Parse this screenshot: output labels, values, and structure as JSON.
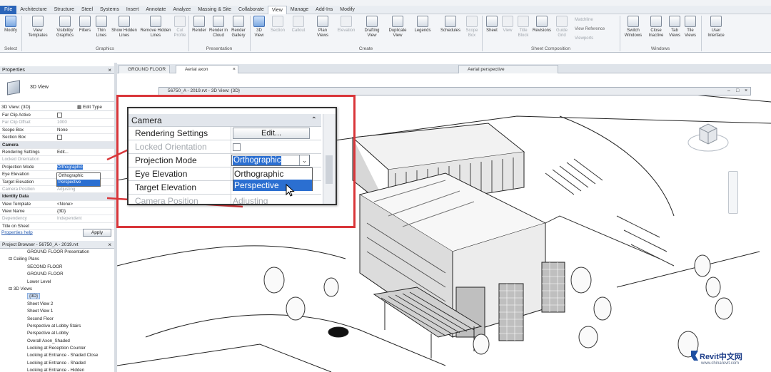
{
  "menubar": {
    "items": [
      "File",
      "Architecture",
      "Structure",
      "Steel",
      "Systems",
      "Insert",
      "Annotate",
      "Analyze",
      "Massing & Site",
      "Collaborate",
      "View",
      "Manage",
      "Add-Ins",
      "Modify"
    ],
    "active": "View"
  },
  "ribbon": {
    "buttons": {
      "modify": "Modify",
      "view_templates": "View Templates",
      "visibility_graphics": "Visibility/ Graphics",
      "filters": "Filters",
      "thin_lines": "Thin Lines",
      "show_hidden_lines": "Show Hidden Lines",
      "remove_hidden_lines": "Remove Hidden Lines",
      "cut_profile": "Cut Profile",
      "render": "Render",
      "render_cloud": "Render in Cloud",
      "render_gallery": "Render Gallery",
      "view_3d": "3D View",
      "section": "Section",
      "callout": "Callout",
      "plan_views": "Plan Views",
      "elevation": "Elevation",
      "drafting_view": "Drafting View",
      "duplicate_view": "Duplicate View",
      "legends": "Legends",
      "schedules": "Schedules",
      "scope_box": "Scope Box",
      "sheet": "Sheet",
      "view": "View",
      "title_block": "Title Block",
      "revisions": "Revisions",
      "guide_grid": "Guide Grid",
      "switch_windows": "Switch Windows",
      "close_inactive": "Close Inactive",
      "tab_views": "Tab Views",
      "tile_views": "Tile Views",
      "user_interface": "User Interface"
    },
    "small": {
      "matchline": "Matchline",
      "view_reference": "View  Reference",
      "viewports": "Viewports"
    },
    "groups": {
      "select": "Select",
      "graphics": "Graphics",
      "presentation": "Presentation",
      "create": "Create",
      "sheet_composition": "Sheet Composition",
      "windows": "Windows"
    }
  },
  "properties": {
    "title": "Properties",
    "type_name": "3D View",
    "instance_selector": "3D View: {3D}",
    "edit_type": "Edit Type",
    "rows": [
      {
        "k": "Far Clip Active",
        "v": "",
        "cb": true
      },
      {
        "k": "Far Clip Offset",
        "v": "1000",
        "dim": true
      },
      {
        "k": "Scope Box",
        "v": "None"
      },
      {
        "k": "Section Box",
        "v": "",
        "cb": true
      },
      {
        "k": "Camera",
        "v": "",
        "section": true
      },
      {
        "k": "Rendering Settings",
        "v": "Edit..."
      },
      {
        "k": "Locked Orientation",
        "v": "",
        "dim": true
      },
      {
        "k": "Projection Mode",
        "v": "Orthographic",
        "selected": true
      },
      {
        "k": "Eye Elevation",
        "v": ""
      },
      {
        "k": "Target Elevation",
        "v": ""
      },
      {
        "k": "Camera Position",
        "v": "Adjusting",
        "dim": true
      },
      {
        "k": "Identity Data",
        "v": "",
        "section": true
      },
      {
        "k": "View Template",
        "v": "<None>"
      },
      {
        "k": "View Name",
        "v": "{3D}"
      },
      {
        "k": "Dependency",
        "v": "Independent",
        "dim": true
      },
      {
        "k": "Title on Sheet",
        "v": ""
      }
    ],
    "dropdown": [
      "Orthographic",
      "Perspective"
    ],
    "help_link": "Properties help",
    "apply": "Apply"
  },
  "project_browser": {
    "title": "Project Browser - 56750_A - 2019.rvt",
    "items": [
      {
        "t": "GROUND FLOOR Presentation",
        "lvl": 3
      },
      {
        "t": "Ceiling Plans",
        "lvl": 1
      },
      {
        "t": "SECOND FLOOR",
        "lvl": 3
      },
      {
        "t": "GROUND FLOOR",
        "lvl": 3
      },
      {
        "t": "Lower Level",
        "lvl": 3
      },
      {
        "t": "3D Views",
        "lvl": 1
      },
      {
        "t": "{3D}",
        "lvl": 3,
        "sel": true
      },
      {
        "t": "Sheet View 2",
        "lvl": 3
      },
      {
        "t": "Sheet View 1",
        "lvl": 3
      },
      {
        "t": "Second Floor",
        "lvl": 3
      },
      {
        "t": "Perspective at Lobby Stairs",
        "lvl": 3
      },
      {
        "t": "Perspective at Lobby",
        "lvl": 3
      },
      {
        "t": "Overall Axon_Shaded",
        "lvl": 3
      },
      {
        "t": "Looking at Reception Counter",
        "lvl": 3
      },
      {
        "t": "Looking at Entrance - Shaded Close",
        "lvl": 3
      },
      {
        "t": "Looking at Entrance - Shaded",
        "lvl": 3
      },
      {
        "t": "Looking at Entrance - Hidden",
        "lvl": 3
      }
    ]
  },
  "view_tabs": [
    "GROUND FLOOR",
    "Aerial axon",
    "Aerial perspective"
  ],
  "subwindow_title": "56750_A - 2019.rvt - 3D View: {3D}",
  "zoom": {
    "section": "Camera",
    "rows": [
      {
        "k": "Rendering Settings",
        "v": "Edit..."
      },
      {
        "k": "Locked Orientation",
        "v": ""
      },
      {
        "k": "Projection Mode",
        "v": "Orthographic"
      },
      {
        "k": "Eye Elevation",
        "v": ""
      },
      {
        "k": "Target Elevation",
        "v": ""
      },
      {
        "k": "Camera Position",
        "v": "Adjusting"
      }
    ],
    "options": [
      "Orthographic",
      "Perspective"
    ]
  },
  "watermark": {
    "brand": "Revit中文网",
    "url": "www.chinarevit.com"
  },
  "colors": {
    "accent_red": "#d9363a",
    "selection_blue": "#2b6fd1",
    "file_tab": "#2a64b8"
  }
}
